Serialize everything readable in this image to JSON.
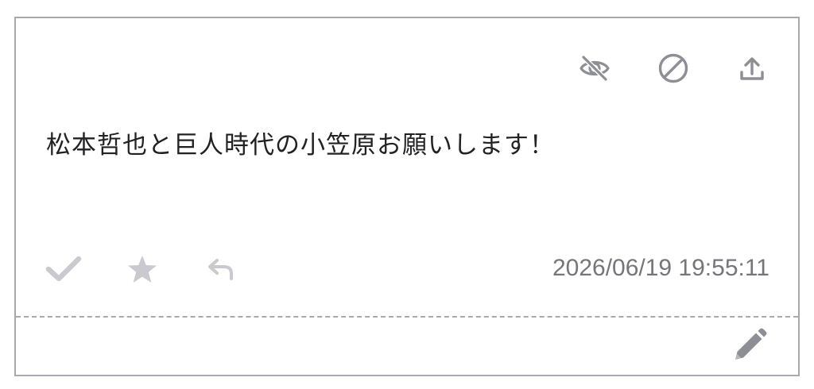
{
  "colors": {
    "border": "#a8a8ae",
    "icon_dark": "#8e8e95",
    "icon_light": "#c9c9cf",
    "text": "#222225",
    "timestamp": "#75757c"
  },
  "top_actions": [
    {
      "icon": "eye-off-icon",
      "name": "hide-button"
    },
    {
      "icon": "block-icon",
      "name": "block-button"
    },
    {
      "icon": "upload-icon",
      "name": "share-button"
    }
  ],
  "message": {
    "text": "松本哲也と巨人時代の小笠原お願いします！"
  },
  "bottom_actions": [
    {
      "icon": "check-icon",
      "name": "check-button"
    },
    {
      "icon": "star-icon",
      "name": "favorite-button"
    },
    {
      "icon": "reply-icon",
      "name": "reply-button"
    }
  ],
  "timestamp": "2026/06/19 19:55:11",
  "footer": {
    "edit_icon": "pencil-icon"
  }
}
